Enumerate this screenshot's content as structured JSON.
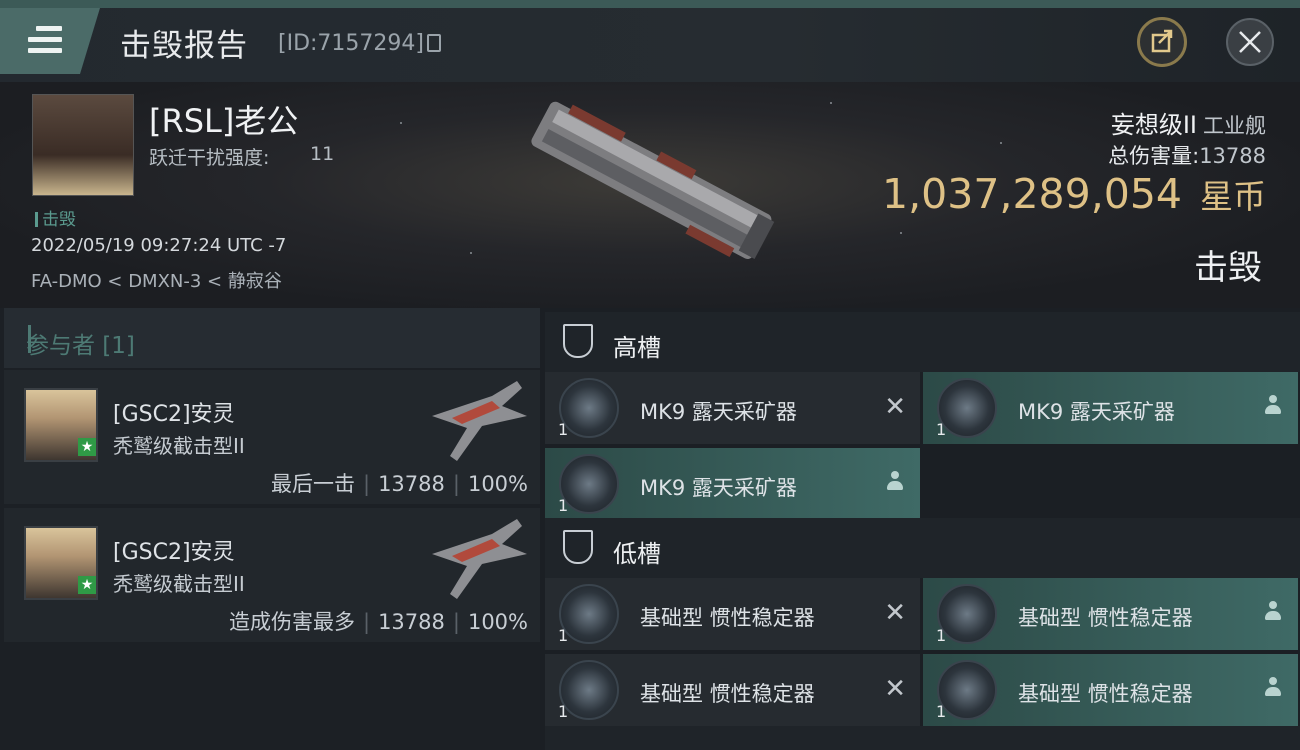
{
  "header": {
    "title": "击毁报告",
    "report_id": "[ID:7157294]"
  },
  "victim": {
    "pilot_name": "[RSL]老公",
    "disrupt_label": "跃迁干扰强度:",
    "disrupt_value": "11",
    "status_tag": "击毁",
    "datetime": "2022/05/19 09:27:24 UTC -7",
    "location": "FA-DMO < DMXN-3 < 静寂谷",
    "ship_name": "妄想级II",
    "ship_class": "工业舰",
    "total_damage_label": "总伤害量:",
    "total_damage_value": "13788",
    "isk_value": "1,037,289,054",
    "isk_unit": "星币",
    "result": "击毁"
  },
  "participants": {
    "header": "参与者 [1]",
    "rows": [
      {
        "name": "[GSC2]安灵",
        "ship": "秃鹫级截击型II",
        "role": "最后一击",
        "damage": "13788",
        "percent": "100%"
      },
      {
        "name": "[GSC2]安灵",
        "ship": "秃鹫级截击型II",
        "role": "造成伤害最多",
        "damage": "13788",
        "percent": "100%"
      }
    ]
  },
  "slots": {
    "high": {
      "label": "高槽",
      "modules": [
        {
          "name": "MK9 露天采矿器",
          "qty": "1",
          "state": "destroyed"
        },
        {
          "name": "MK9 露天采矿器",
          "qty": "1",
          "state": "dropped"
        },
        {
          "name": "MK9 露天采矿器",
          "qty": "1",
          "state": "dropped"
        }
      ]
    },
    "low": {
      "label": "低槽",
      "modules": [
        {
          "name": "基础型 惯性稳定器",
          "qty": "1",
          "state": "destroyed"
        },
        {
          "name": "基础型 惯性稳定器",
          "qty": "1",
          "state": "dropped"
        },
        {
          "name": "基础型 惯性稳定器",
          "qty": "1",
          "state": "destroyed"
        },
        {
          "name": "基础型 惯性稳定器",
          "qty": "1",
          "state": "dropped"
        }
      ]
    }
  },
  "icons": {
    "menu": "hamburger-icon",
    "share": "share-icon",
    "close": "close-icon",
    "copy": "copy-icon",
    "destroyed": "x-icon",
    "dropped": "person-icon",
    "slot": "shield-slot-icon"
  },
  "colors": {
    "accent_teal": "#4b6b68",
    "isk_gold": "#dec186",
    "corp_badge": "#2f9a46"
  }
}
